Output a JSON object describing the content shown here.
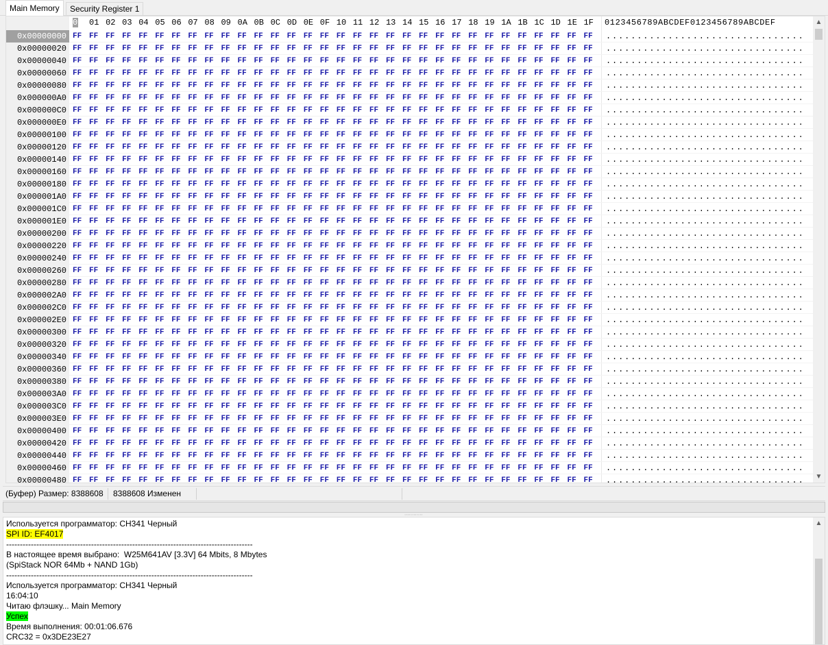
{
  "tabs": [
    {
      "label": "Main Memory",
      "active": true
    },
    {
      "label": "Security Register 1",
      "active": false
    }
  ],
  "hex": {
    "columns": [
      "00",
      "01",
      "02",
      "03",
      "04",
      "05",
      "06",
      "07",
      "08",
      "09",
      "0A",
      "0B",
      "0C",
      "0D",
      "0E",
      "0F",
      "10",
      "11",
      "12",
      "13",
      "14",
      "15",
      "16",
      "17",
      "18",
      "19",
      "1A",
      "1B",
      "1C",
      "1D",
      "1E",
      "1F"
    ],
    "ascii_header": "0123456789ABCDEF0123456789ABCDEF",
    "rows": [
      "0x00000000",
      "0x00000020",
      "0x00000040",
      "0x00000060",
      "0x00000080",
      "0x000000A0",
      "0x000000C0",
      "0x000000E0",
      "0x00000100",
      "0x00000120",
      "0x00000140",
      "0x00000160",
      "0x00000180",
      "0x000001A0",
      "0x000001C0",
      "0x000001E0",
      "0x00000200",
      "0x00000220",
      "0x00000240",
      "0x00000260",
      "0x00000280",
      "0x000002A0",
      "0x000002C0",
      "0x000002E0",
      "0x00000300",
      "0x00000320",
      "0x00000340",
      "0x00000360",
      "0x00000380",
      "0x000003A0",
      "0x000003C0",
      "0x000003E0",
      "0x00000400",
      "0x00000420",
      "0x00000440",
      "0x00000460",
      "0x00000480"
    ],
    "byte_value": "FF",
    "ascii_row": "................................",
    "byte_color": "#1a1aa8"
  },
  "status": {
    "buffer_size": "(Буфер) Размер: 8388608",
    "changed": "8388608 Изменен"
  },
  "log": [
    {
      "text": "Используется программатор: CH341 Черный",
      "hl": ""
    },
    {
      "text": "SPI ID: EF4017",
      "hl": "yellow"
    },
    {
      "text": "------------------------------------------------------------------------------------------",
      "hl": ""
    },
    {
      "text": "В настоящее время выбрано:  W25M641AV [3.3V] 64 Mbits, 8 Mbytes",
      "hl": ""
    },
    {
      "text": "(SpiStack NOR 64Mb + NAND 1Gb)",
      "hl": ""
    },
    {
      "text": "------------------------------------------------------------------------------------------",
      "hl": ""
    },
    {
      "text": "Используется программатор: CH341 Черный",
      "hl": ""
    },
    {
      "text": "16:04:10",
      "hl": ""
    },
    {
      "text": "Читаю флэшку... Main Memory",
      "hl": ""
    },
    {
      "text": "Успех",
      "hl": "green"
    },
    {
      "text": "Время выполнения: 00:01:06.676",
      "hl": ""
    },
    {
      "text": "CRC32 = 0x3DE23E27",
      "hl": ""
    }
  ]
}
